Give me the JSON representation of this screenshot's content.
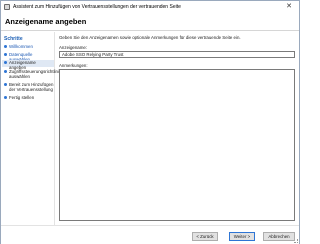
{
  "window": {
    "title": "Assistent zum Hinzufügen von Vertrauensstellungen der vertrauenden Seite",
    "close_glyph": "✕"
  },
  "header": {
    "page_title": "Anzeigename angeben"
  },
  "sidebar": {
    "steps_heading": "Schritte",
    "steps": [
      {
        "label": "Willkommen",
        "state": "done"
      },
      {
        "label": "Datenquelle auswählen",
        "state": "done"
      },
      {
        "label": "Anzeigename angeben",
        "state": "active"
      },
      {
        "label": "Zugriffssteuerungsrichtlinie auswählen",
        "state": "future"
      },
      {
        "label": "Bereit zum Hinzufügen der Vertrauensstellung",
        "state": "future"
      },
      {
        "label": "Fertig stellen",
        "state": "future"
      }
    ]
  },
  "main": {
    "intro": "Geben Sie den Anzeigenamen sowie optionale Anmerkungen für diese vertrauende Seite ein.",
    "display_name_label": "Anzeigename:",
    "display_name_value": "Adobe SSO Relying Party Trust",
    "notes_label": "Anmerkungen:",
    "notes_value": ""
  },
  "footer": {
    "back_label": "< Zurück",
    "next_label": "Weiter >",
    "cancel_label": "Abbrechen"
  },
  "colors": {
    "link": "#1a57b3",
    "active_step_bg": "#dfe8f4",
    "primary_border": "#2e75d4"
  }
}
